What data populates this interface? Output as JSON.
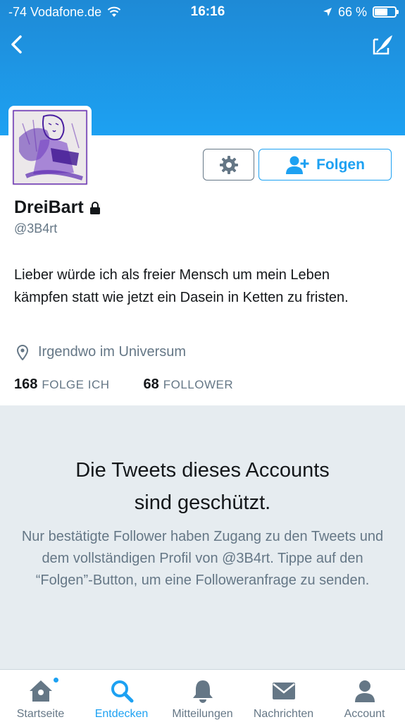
{
  "status_bar": {
    "carrier": "-74 Vodafone.de",
    "time": "16:16",
    "battery": "66 %",
    "battery_level": 0.66
  },
  "profile": {
    "name": "DreiBart",
    "handle": "@3B4rt",
    "bio": "Lieber würde ich als freier Mensch um mein Leben kämpfen statt wie jetzt ein Dasein in Ketten zu fristen.",
    "location": "Irgendwo im Universum",
    "following_count": "168",
    "following_label": "FOLGE ICH",
    "followers_count": "68",
    "followers_label": "FOLLOWER",
    "follow_button_label": "Folgen"
  },
  "protected": {
    "title_line1": "Die Tweets dieses Accounts",
    "title_line2": "sind geschützt.",
    "message": "Nur bestätigte Follower haben Zugang zu den Tweets und dem vollständigen Profil von @3B4rt. Tippe auf den “Folgen”-Button, um eine Followeranfrage zu senden."
  },
  "tabs": [
    {
      "label": "Startseite",
      "icon": "home-icon"
    },
    {
      "label": "Entdecken",
      "icon": "search-icon"
    },
    {
      "label": "Mitteilungen",
      "icon": "bell-icon"
    },
    {
      "label": "Nachrichten",
      "icon": "envelope-icon"
    },
    {
      "label": "Account",
      "icon": "person-icon"
    }
  ],
  "colors": {
    "accent": "#1da1f2",
    "header_top": "#1e8ad6",
    "muted": "#657786",
    "background": "#e6ecf0"
  }
}
